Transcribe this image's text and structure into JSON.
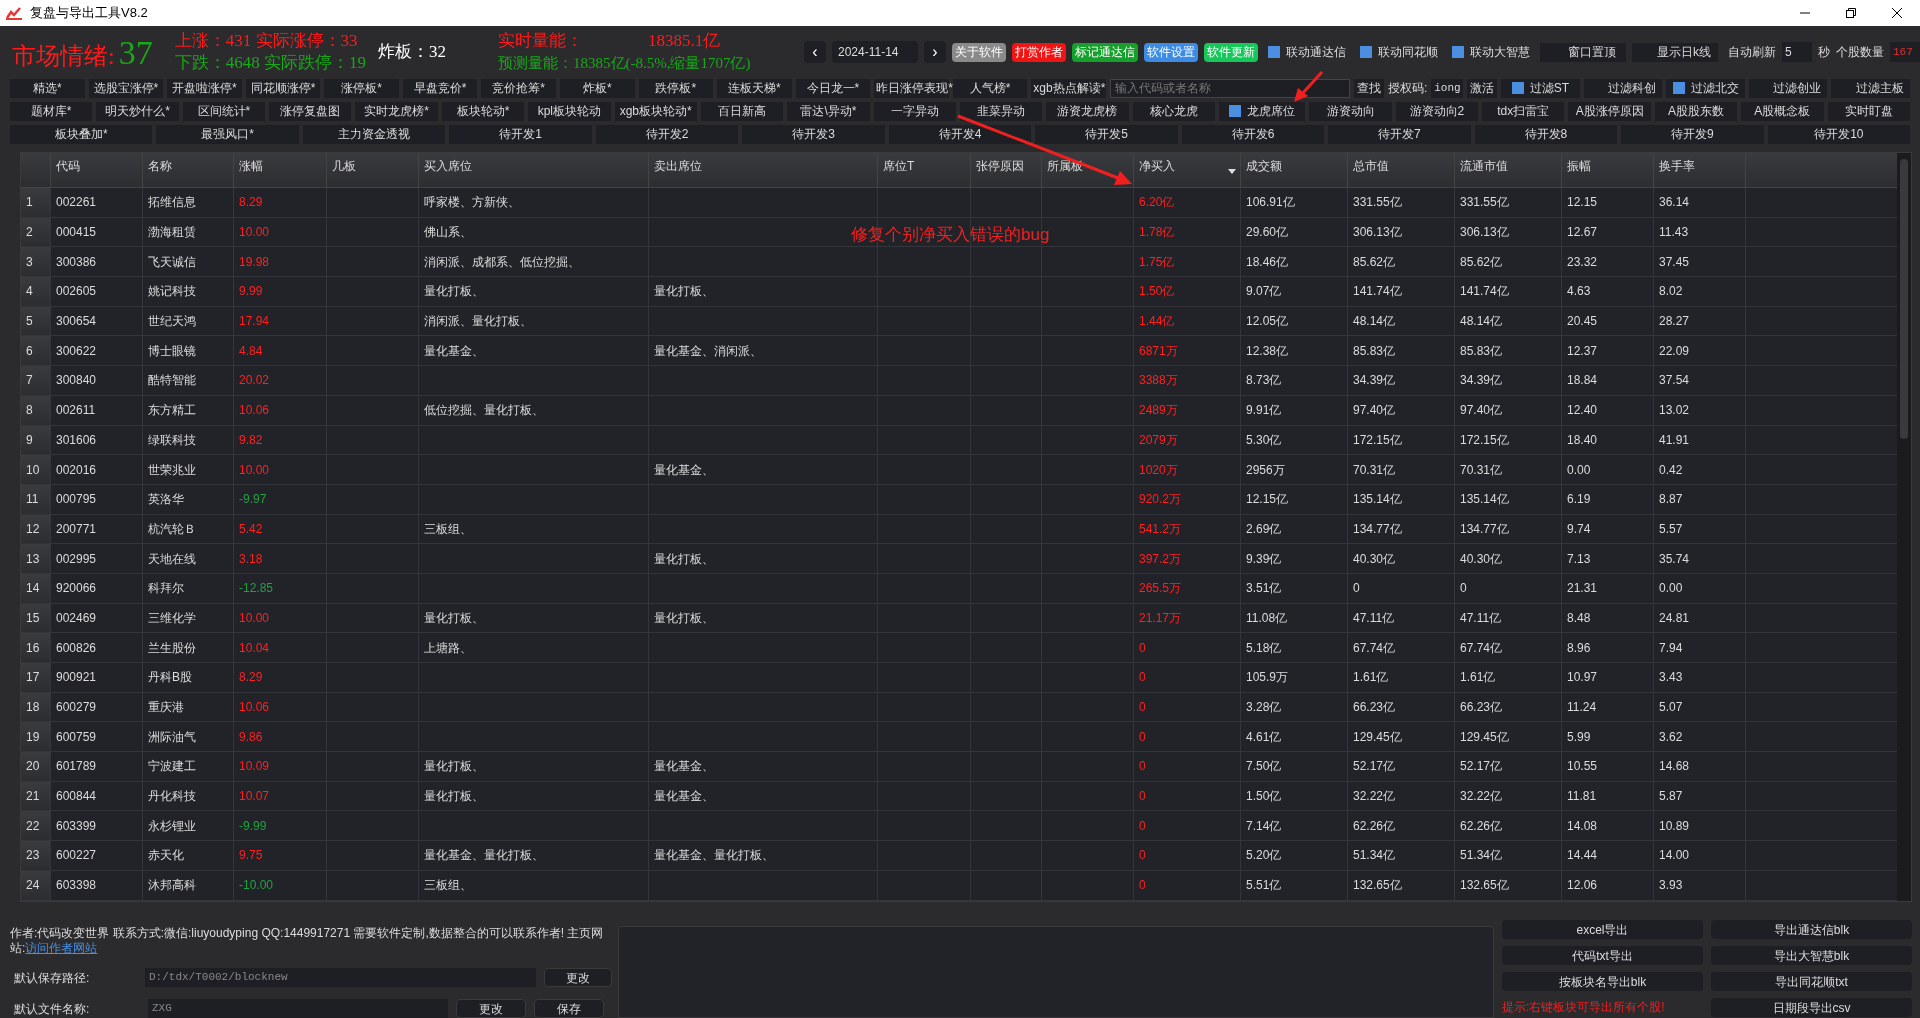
{
  "window": {
    "title": "复盘与导出工具V8.2"
  },
  "market": {
    "mood_label": "市场情绪:",
    "mood_value": "37",
    "up": "上涨：431",
    "limit_up": "实际涨停：33",
    "down": "下跌：4648",
    "limit_down": "实际跌停：19",
    "broken": "炸板：32",
    "volume_label": "实时量能：",
    "volume_value": "18385.1亿",
    "forecast": "预测量能：18385亿(-8.5%,缩量1707亿)"
  },
  "date_picker": {
    "prev": "‹",
    "value": "2024-11-14",
    "next": "›"
  },
  "top_buttons": [
    {
      "label": "关于软件",
      "color": "#8a8a8a"
    },
    {
      "label": "打赏作者",
      "color": "#f01414"
    },
    {
      "label": "标记通达信",
      "color": "#14a02a"
    },
    {
      "label": "软件设置",
      "color": "#3c8ce6"
    },
    {
      "label": "软件更新",
      "color": "#16c85a"
    }
  ],
  "top_options": [
    {
      "label": "联动通达信",
      "checked": true
    },
    {
      "label": "联动同花顺",
      "checked": true
    },
    {
      "label": "联动大智慧",
      "checked": true
    },
    {
      "label": "窗口置顶",
      "checked": false
    },
    {
      "label": "显示日k线",
      "checked": false
    }
  ],
  "refresh": {
    "label": "自动刷新",
    "value": "5",
    "unit": "秒"
  },
  "stock_count": {
    "label": "个股数量",
    "value": "167"
  },
  "toolbar_rows": [
    [
      {
        "kind": "button",
        "label": "精选*"
      },
      {
        "kind": "button",
        "label": "选股宝涨停*"
      },
      {
        "kind": "button",
        "label": "开盘啦涨停*"
      },
      {
        "kind": "button",
        "label": "同花顺涨停*"
      },
      {
        "kind": "button",
        "label": "涨停板*"
      },
      {
        "kind": "button",
        "label": "早盘竞价*"
      },
      {
        "kind": "button",
        "label": "竞价抢筹*"
      },
      {
        "kind": "button",
        "label": "炸板*"
      },
      {
        "kind": "button",
        "label": "跌停板*"
      },
      {
        "kind": "button",
        "label": "连板天梯*"
      },
      {
        "kind": "button",
        "label": "今日龙一*"
      },
      {
        "kind": "button",
        "label": "昨日涨停表现*"
      },
      {
        "kind": "button",
        "label": "人气榜*"
      },
      {
        "kind": "button",
        "label": "xgb热点解读*"
      },
      {
        "kind": "search",
        "placeholder": "输入代码或者名称"
      },
      {
        "kind": "plain",
        "label": "查找"
      },
      {
        "kind": "text",
        "label": "授权码:"
      },
      {
        "kind": "field",
        "value": "iong"
      },
      {
        "kind": "plain",
        "label": "激活"
      },
      {
        "kind": "checkbox",
        "label": "过滤ST",
        "checked": true
      },
      {
        "kind": "checkbox",
        "label": "过滤科创",
        "checked": false
      },
      {
        "kind": "checkbox",
        "label": "过滤北交",
        "checked": true
      },
      {
        "kind": "checkbox",
        "label": "过滤创业",
        "checked": false
      },
      {
        "kind": "checkbox",
        "label": "过滤主板",
        "checked": false
      }
    ],
    [
      {
        "kind": "button",
        "label": "题材库*"
      },
      {
        "kind": "button",
        "label": "明天炒什么*"
      },
      {
        "kind": "button",
        "label": "区间统计*"
      },
      {
        "kind": "button",
        "label": "涨停复盘图"
      },
      {
        "kind": "button",
        "label": "实时龙虎榜*"
      },
      {
        "kind": "button",
        "label": "板块轮动*"
      },
      {
        "kind": "button",
        "label": "kpl板块轮动"
      },
      {
        "kind": "button",
        "label": "xgb板块轮动*"
      },
      {
        "kind": "button",
        "label": "百日新高"
      },
      {
        "kind": "button",
        "label": "雷达\\异动*"
      },
      {
        "kind": "button",
        "label": "一字异动"
      },
      {
        "kind": "button",
        "label": "韭菜异动"
      },
      {
        "kind": "button",
        "label": "游资龙虎榜"
      },
      {
        "kind": "button",
        "label": "核心龙虎"
      },
      {
        "kind": "checkbox",
        "label": "龙虎席位",
        "checked": true
      },
      {
        "kind": "button",
        "label": "游资动向"
      },
      {
        "kind": "button",
        "label": "游资动向2"
      },
      {
        "kind": "button",
        "label": "tdx扫雷宝"
      },
      {
        "kind": "button",
        "label": "A股涨停原因"
      },
      {
        "kind": "button",
        "label": "A股股东数"
      },
      {
        "kind": "button",
        "label": "A股概念板"
      },
      {
        "kind": "button",
        "label": "实时盯盘"
      }
    ],
    [
      {
        "kind": "button",
        "label": "板块叠加*"
      },
      {
        "kind": "button",
        "label": "最强风口*"
      },
      {
        "kind": "button",
        "label": "主力资金透视"
      },
      {
        "kind": "button",
        "label": "待开发1"
      },
      {
        "kind": "button",
        "label": "待开发2"
      },
      {
        "kind": "button",
        "label": "待开发3"
      },
      {
        "kind": "button",
        "label": "待开发4"
      },
      {
        "kind": "button",
        "label": "待开发5"
      },
      {
        "kind": "button",
        "label": "待开发6"
      },
      {
        "kind": "button",
        "label": "待开发7"
      },
      {
        "kind": "button",
        "label": "待开发8"
      },
      {
        "kind": "button",
        "label": "待开发9"
      },
      {
        "kind": "button",
        "label": "待开发10"
      }
    ]
  ],
  "table": {
    "columns": [
      {
        "label": "代码"
      },
      {
        "label": "名称"
      },
      {
        "label": "涨幅"
      },
      {
        "label": "几板"
      },
      {
        "label": "买入席位"
      },
      {
        "label": "卖出席位"
      },
      {
        "label": "席位T"
      },
      {
        "label": "张停原因"
      },
      {
        "label": "所属板"
      },
      {
        "label": "净买入",
        "sorted": true
      },
      {
        "label": "成交额"
      },
      {
        "label": "总市值"
      },
      {
        "label": "流通市值"
      },
      {
        "label": "振幅"
      },
      {
        "label": "换手率"
      }
    ],
    "rows": [
      {
        "rising": true,
        "number": "1",
        "cells": [
          "002261",
          "拓维信息",
          "8.29",
          "",
          "呼家楼、方新侠、",
          "",
          "",
          "",
          "",
          "6.20亿",
          "106.91亿",
          "331.55亿",
          "331.55亿",
          "12.15",
          "36.14"
        ]
      },
      {
        "rising": true,
        "number": "2",
        "cells": [
          "000415",
          "渤海租赁",
          "10.00",
          "",
          "佛山系、",
          "",
          "",
          "",
          "",
          "1.78亿",
          "29.60亿",
          "306.13亿",
          "306.13亿",
          "12.67",
          "11.43"
        ]
      },
      {
        "rising": true,
        "number": "3",
        "cells": [
          "300386",
          "飞天诚信",
          "19.98",
          "",
          "消闲派、成都系、低位挖掘、",
          "",
          "",
          "",
          "",
          "1.75亿",
          "18.46亿",
          "85.62亿",
          "85.62亿",
          "23.32",
          "37.45"
        ]
      },
      {
        "rising": true,
        "number": "4",
        "cells": [
          "002605",
          "姚记科技",
          "9.99",
          "",
          "量化打板、",
          "量化打板、",
          "",
          "",
          "",
          "1.50亿",
          "9.07亿",
          "141.74亿",
          "141.74亿",
          "4.63",
          "8.02"
        ]
      },
      {
        "rising": true,
        "number": "5",
        "cells": [
          "300654",
          "世纪天鸿",
          "17.94",
          "",
          "消闲派、量化打板、",
          "",
          "",
          "",
          "",
          "1.44亿",
          "12.05亿",
          "48.14亿",
          "48.14亿",
          "20.45",
          "28.27"
        ]
      },
      {
        "rising": true,
        "number": "6",
        "cells": [
          "300622",
          "博士眼镜",
          "4.84",
          "",
          "量化基金、",
          "量化基金、消闲派、",
          "",
          "",
          "",
          "6871万",
          "12.38亿",
          "85.83亿",
          "85.83亿",
          "12.37",
          "22.09"
        ]
      },
      {
        "rising": true,
        "number": "7",
        "cells": [
          "300840",
          "酷特智能",
          "20.02",
          "",
          "",
          "",
          "",
          "",
          "",
          "3388万",
          "8.73亿",
          "34.39亿",
          "34.39亿",
          "18.84",
          "37.54"
        ]
      },
      {
        "rising": true,
        "number": "8",
        "cells": [
          "002611",
          "东方精工",
          "10.06",
          "",
          "低位挖掘、量化打板、",
          "",
          "",
          "",
          "",
          "2489万",
          "9.91亿",
          "97.40亿",
          "97.40亿",
          "12.40",
          "13.02"
        ]
      },
      {
        "rising": true,
        "number": "9",
        "cells": [
          "301606",
          "绿联科技",
          "9.82",
          "",
          "",
          "",
          "",
          "",
          "",
          "2079万",
          "5.30亿",
          "172.15亿",
          "172.15亿",
          "18.40",
          "41.91"
        ]
      },
      {
        "rising": true,
        "number": "10",
        "cells": [
          "002016",
          "世荣兆业",
          "10.00",
          "",
          "",
          "量化基金、",
          "",
          "",
          "",
          "1020万",
          "2956万",
          "70.31亿",
          "70.31亿",
          "0.00",
          "0.42"
        ]
      },
      {
        "rising": false,
        "number": "11",
        "cells": [
          "000795",
          "英洛华",
          "-9.97",
          "",
          "",
          "",
          "",
          "",
          "",
          "920.2万",
          "12.15亿",
          "135.14亿",
          "135.14亿",
          "6.19",
          "8.87"
        ]
      },
      {
        "rising": true,
        "number": "12",
        "cells": [
          "200771",
          "杭汽轮Ｂ",
          "5.42",
          "",
          "三板组、",
          "",
          "",
          "",
          "",
          "541.2万",
          "2.69亿",
          "134.77亿",
          "134.77亿",
          "9.74",
          "5.57"
        ]
      },
      {
        "rising": true,
        "number": "13",
        "cells": [
          "002995",
          "天地在线",
          "3.18",
          "",
          "",
          "量化打板、",
          "",
          "",
          "",
          "397.2万",
          "9.39亿",
          "40.30亿",
          "40.30亿",
          "7.13",
          "35.74"
        ]
      },
      {
        "rising": false,
        "number": "14",
        "cells": [
          "920066",
          "科拜尔",
          "-12.85",
          "",
          "",
          "",
          "",
          "",
          "",
          "265.5万",
          "3.51亿",
          "0",
          "0",
          "21.31",
          "0.00"
        ]
      },
      {
        "rising": true,
        "number": "15",
        "cells": [
          "002469",
          "三维化学",
          "10.00",
          "",
          "量化打板、",
          "量化打板、",
          "",
          "",
          "",
          "21.17万",
          "11.08亿",
          "47.11亿",
          "47.11亿",
          "8.48",
          "24.81"
        ]
      },
      {
        "rising": true,
        "number": "16",
        "cells": [
          "600826",
          "兰生股份",
          "10.04",
          "",
          "上塘路、",
          "",
          "",
          "",
          "",
          "0",
          "5.18亿",
          "67.74亿",
          "67.74亿",
          "8.96",
          "7.94"
        ]
      },
      {
        "rising": true,
        "number": "17",
        "cells": [
          "900921",
          "丹科B股",
          "8.29",
          "",
          "",
          "",
          "",
          "",
          "",
          "0",
          "105.9万",
          "1.61亿",
          "1.61亿",
          "10.97",
          "3.43"
        ]
      },
      {
        "rising": true,
        "number": "18",
        "cells": [
          "600279",
          "重庆港",
          "10.06",
          "",
          "",
          "",
          "",
          "",
          "",
          "0",
          "3.28亿",
          "66.23亿",
          "66.23亿",
          "11.24",
          "5.07"
        ]
      },
      {
        "rising": true,
        "number": "19",
        "cells": [
          "600759",
          "洲际油气",
          "9.86",
          "",
          "",
          "",
          "",
          "",
          "",
          "0",
          "4.61亿",
          "129.45亿",
          "129.45亿",
          "5.99",
          "3.62"
        ]
      },
      {
        "rising": true,
        "number": "20",
        "cells": [
          "601789",
          "宁波建工",
          "10.09",
          "",
          "量化打板、",
          "量化基金、",
          "",
          "",
          "",
          "0",
          "7.50亿",
          "52.17亿",
          "52.17亿",
          "10.55",
          "14.68"
        ]
      },
      {
        "rising": true,
        "number": "21",
        "cells": [
          "600844",
          "丹化科技",
          "10.07",
          "",
          "量化打板、",
          "量化基金、",
          "",
          "",
          "",
          "0",
          "1.50亿",
          "32.22亿",
          "32.22亿",
          "11.81",
          "5.87"
        ]
      },
      {
        "rising": false,
        "number": "22",
        "cells": [
          "603399",
          "永杉锂业",
          "-9.99",
          "",
          "",
          "",
          "",
          "",
          "",
          "0",
          "7.14亿",
          "62.26亿",
          "62.26亿",
          "14.08",
          "10.89"
        ]
      },
      {
        "rising": true,
        "number": "23",
        "cells": [
          "600227",
          "赤天化",
          "9.75",
          "",
          "量化基金、量化打板、",
          "量化基金、量化打板、",
          "",
          "",
          "",
          "0",
          "5.20亿",
          "51.34亿",
          "51.34亿",
          "14.44",
          "14.00"
        ]
      },
      {
        "rising": false,
        "number": "24",
        "cells": [
          "603398",
          "沐邦高科",
          "-10.00",
          "",
          "三板组、",
          "",
          "",
          "",
          "",
          "0",
          "5.51亿",
          "132.65亿",
          "132.65亿",
          "12.06",
          "3.93"
        ]
      }
    ]
  },
  "annotation": {
    "text": "修复个别净买入错误的bug"
  },
  "footer": {
    "author": "作者:代码改变世界 联系方式:微信:liuyoudyping QQ:1449917271 需要软件定制,数据整合的可以联系作者! 主页网站:",
    "link": "访问作者网站",
    "path_label": "默认保存路径:",
    "path_value": "D:/tdx/T0002/blocknew",
    "path_button": "更改",
    "file_label": "默认文件名称:",
    "file_value": "ZXG",
    "file_button": "更改",
    "save_button": "保存",
    "export_buttons": [
      "excel导出",
      "导出通达信blk",
      "代码txt导出",
      "导出大智慧blk",
      "按板块名导出blk",
      "导出同花顺txt"
    ],
    "hint": "提示:右键板块可导出所有个股!",
    "date_export": "日期段导出csv"
  }
}
